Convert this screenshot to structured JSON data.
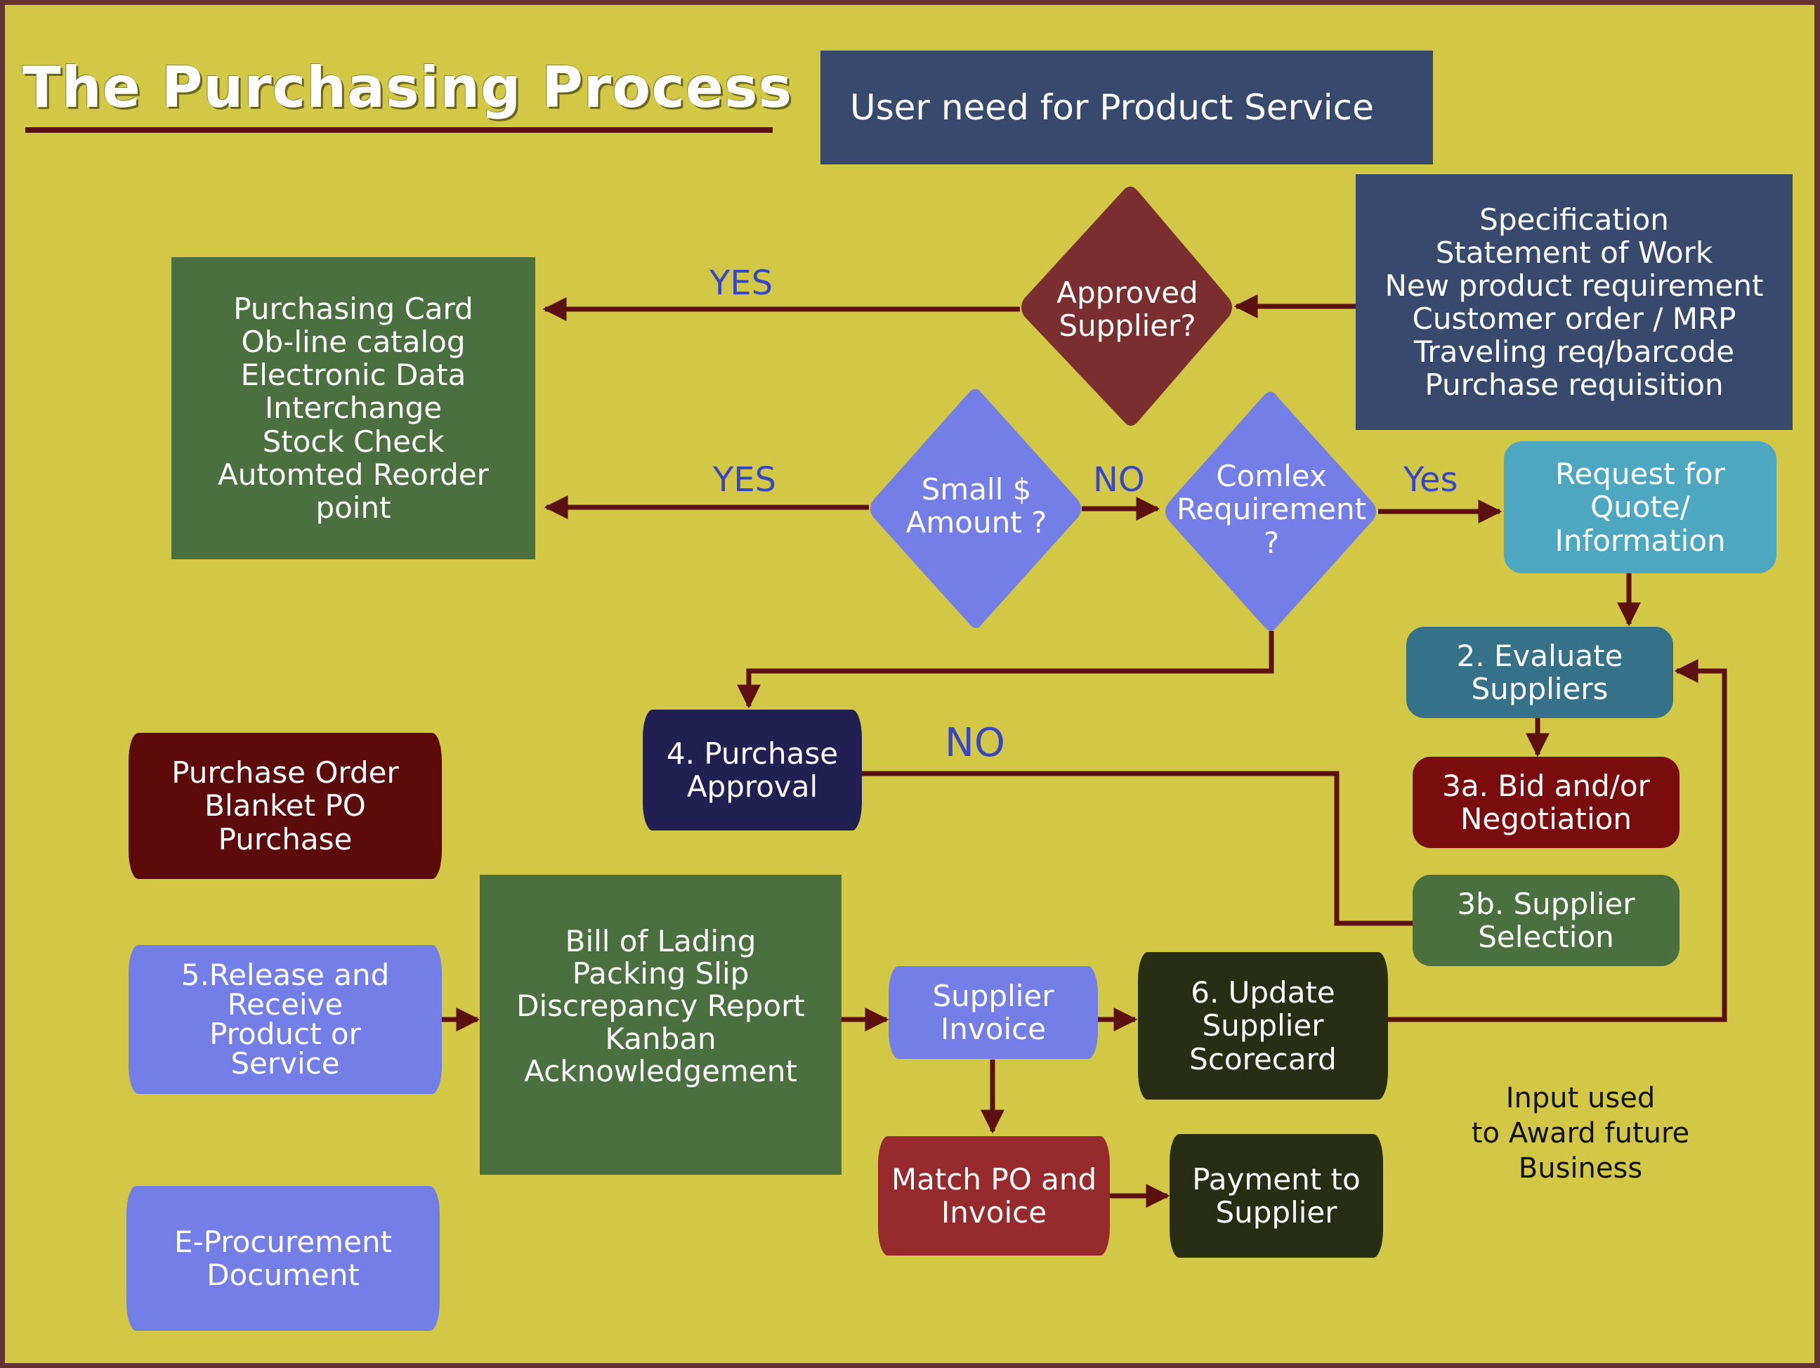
{
  "title": "The Purchasing Process",
  "colors": {
    "background": "#d3c845",
    "frame": "#663333",
    "arrow": "#5c1010",
    "branch_label": "#3547c8"
  },
  "nodes": {
    "user_need": {
      "text": "User need for Product Service",
      "color": "#374a6d",
      "shape": "rectangle"
    },
    "requirements": {
      "text": "Specification\nStatement of Work\nNew product requirement\nCustomer order / MRP\nTraveling req/barcode\nPurchase requisition",
      "color": "#374a6d",
      "shape": "rectangle"
    },
    "approved_supplier": {
      "text": "Approved\nSupplier?",
      "color": "#7a2e30",
      "shape": "diamond"
    },
    "low_value_methods": {
      "text": "Purchasing Card\nOb-line catalog\nElectronic Data\nInterchange\nStock Check\nAutomted Reorder\npoint",
      "color": "#4a7040",
      "shape": "rectangle"
    },
    "small_amount": {
      "text": "Small $\nAmount ?",
      "color": "#737ee6",
      "shape": "diamond"
    },
    "complex_requirement": {
      "text": "Comlex\nRequirement\n?",
      "color": "#737ee6",
      "shape": "diamond"
    },
    "rfq": {
      "text": "Request for\nQuote/\nInformation",
      "color": "#4ea7c0",
      "shape": "rounded"
    },
    "evaluate_suppliers": {
      "text": "2. Evaluate\nSuppliers",
      "color": "#36718a",
      "shape": "rounded"
    },
    "bid_negotiation": {
      "text": "3a. Bid and/or\nNegotiation",
      "color": "#7a0c0e",
      "shape": "rounded"
    },
    "supplier_selection": {
      "text": "3b. Supplier\nSelection",
      "color": "#4a7040",
      "shape": "rounded"
    },
    "purchase_approval": {
      "text": "4. Purchase\nApproval",
      "color": "#221f52",
      "shape": "wavy"
    },
    "purchase_order": {
      "text": "Purchase Order\nBlanket PO\nPurchase",
      "color": "#5c0a0a",
      "shape": "wavy"
    },
    "release_receive": {
      "text": "5.Release and\nReceive\nProduct or\nService",
      "color": "#737ee6",
      "shape": "wavy"
    },
    "receiving_docs": {
      "text": "Bill of Lading\nPacking Slip\nDiscrepancy Report\nKanban\nAcknowledgement",
      "color": "#4a7040",
      "shape": "rectangle"
    },
    "supplier_invoice": {
      "text": "Supplier\nInvoice",
      "color": "#737ee6",
      "shape": "wavy"
    },
    "update_scorecard": {
      "text": "6. Update\nSupplier\nScorecard",
      "color": "#272e14",
      "shape": "wavy"
    },
    "match_po_invoice": {
      "text": "Match PO and\nInvoice",
      "color": "#962a2c",
      "shape": "wavy"
    },
    "payment": {
      "text": "Payment to\nSupplier",
      "color": "#272e14",
      "shape": "wavy"
    },
    "e_procurement": {
      "text": "E-Procurement\nDocument",
      "color": "#737ee6",
      "shape": "wavy"
    }
  },
  "branch_labels": {
    "approved_yes": "YES",
    "small_yes": "YES",
    "small_no": "NO",
    "complex_yes": "Yes",
    "approval_no": "NO"
  },
  "note": "Input used\nto Award future\nBusiness",
  "connections": [
    {
      "from": "requirements",
      "to": "approved_supplier"
    },
    {
      "from": "approved_supplier",
      "to": "low_value_methods",
      "label": "YES"
    },
    {
      "from": "small_amount",
      "to": "low_value_methods",
      "label": "YES"
    },
    {
      "from": "small_amount",
      "to": "complex_requirement",
      "label": "NO"
    },
    {
      "from": "complex_requirement",
      "to": "rfq",
      "label": "Yes"
    },
    {
      "from": "complex_requirement",
      "to": "purchase_approval"
    },
    {
      "from": "rfq",
      "to": "evaluate_suppliers"
    },
    {
      "from": "evaluate_suppliers",
      "to": "bid_negotiation"
    },
    {
      "from": "supplier_selection",
      "to": "purchase_approval",
      "label": "NO"
    },
    {
      "from": "release_receive",
      "to": "receiving_docs"
    },
    {
      "from": "receiving_docs",
      "to": "supplier_invoice"
    },
    {
      "from": "supplier_invoice",
      "to": "update_scorecard"
    },
    {
      "from": "supplier_invoice",
      "to": "match_po_invoice"
    },
    {
      "from": "match_po_invoice",
      "to": "payment"
    },
    {
      "from": "update_scorecard",
      "to": "evaluate_suppliers"
    }
  ]
}
